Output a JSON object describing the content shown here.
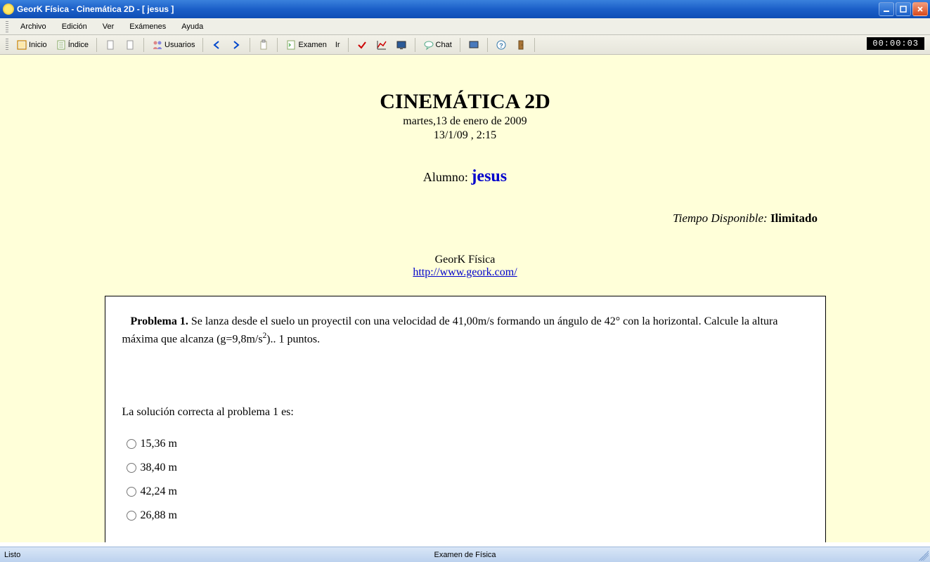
{
  "window": {
    "title": "GeorK Física - Cinemática 2D - [ jesus ]"
  },
  "menu": {
    "items": [
      "Archivo",
      "Edición",
      "Ver",
      "Exámenes",
      "Ayuda"
    ]
  },
  "toolbar": {
    "inicio": "Inicio",
    "indice": "Índice",
    "usuarios": "Usuarios",
    "examen": "Examen",
    "ir": "Ir",
    "chat": "Chat",
    "timer": "00:00:03"
  },
  "exam": {
    "title": "CINEMÁTICA 2D",
    "long_date": "martes,13 de enero de 2009",
    "short_date": "13/1/09 , 2:15",
    "student_label": "Alumno:  ",
    "student_name": "jesus",
    "time_label": "Tiempo Disponible: ",
    "time_value": "Ilimitado",
    "brand": "GeorK Física",
    "url": "http://www.geork.com/"
  },
  "problem": {
    "label": "Problema 1.",
    "text_a": " Se lanza desde el suelo un proyectil con una velocidad de 41,00m/s formando un ángulo de 42° con la horizontal. Calcule la altura máxima que alcanza (g=9,8m/s",
    "text_b": ").. 1 puntos.",
    "prompt": "La solución correcta al problema 1 es:",
    "options": [
      "15,36 m",
      "38,40 m",
      "42,24 m",
      "26,88 m"
    ]
  },
  "status": {
    "left": "Listo",
    "center": "Examen de Física"
  }
}
